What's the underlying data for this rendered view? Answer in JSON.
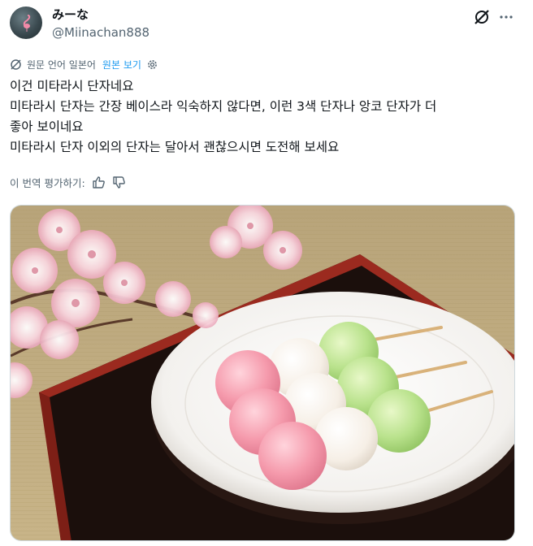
{
  "author": {
    "display_name": "みーな",
    "handle": "@Miinachan888",
    "avatar_icon": "flamingo-avatar"
  },
  "header_actions": {
    "grok_icon": "grok-icon",
    "more_icon": "more-horizontal-icon"
  },
  "translation_bar": {
    "icon": "translate-icon",
    "label": "원문 언어 일본어",
    "link": "원본 보기",
    "settings_icon": "gear-icon"
  },
  "post": {
    "lines": [
      "이건 미타라시 단자네요",
      "미타라시 단자는 간장 베이스라 익숙하지 않다면, 이런 3색 단자나 앙코 단자가 더",
      "좋아 보이네요",
      "미타라시 단자 이외의 단자는 달아서 괜찮으시면 도전해 보세요"
    ]
  },
  "rating": {
    "label": "이 번역 평가하기:",
    "thumbs_up_icon": "thumbs-up-icon",
    "thumbs_down_icon": "thumbs-down-icon"
  },
  "image": {
    "subject": "three-color-dango-photo"
  },
  "colors": {
    "link": "#1d9bf0",
    "muted": "#536471",
    "text": "#0f1419"
  }
}
